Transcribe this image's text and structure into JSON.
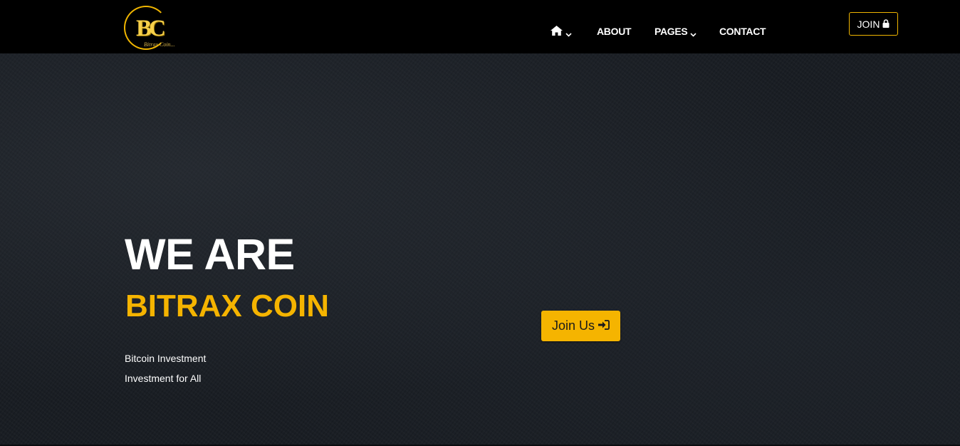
{
  "brand": {
    "logo_letters": "BC",
    "logo_subtext": "Bitrax Coin...",
    "accent_color": "#f5b400"
  },
  "nav": {
    "home_icon": "home-icon",
    "items": [
      {
        "label": "ABOUT"
      },
      {
        "label": "PAGES",
        "has_dropdown": true
      },
      {
        "label": "CONTACT"
      }
    ],
    "join_label": "JOIN",
    "join_icon": "lock-icon"
  },
  "hero": {
    "title": "WE ARE",
    "subtitle": "BITRAX COIN",
    "line1": "Bitcoin Investment",
    "line2": "Investment for All",
    "cta_label": "Join Us",
    "cta_icon": "sign-in-icon"
  }
}
